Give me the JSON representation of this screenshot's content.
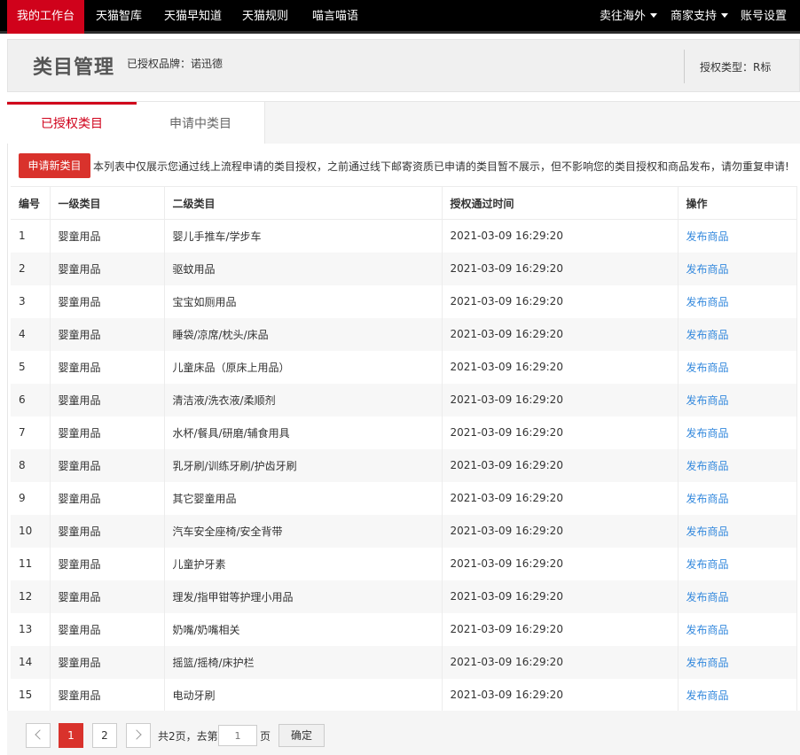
{
  "topnav": {
    "left_items": [
      "我的工作台",
      "天猫智库",
      "天猫早知道",
      "天猫规则",
      "喵言喵语"
    ],
    "right_items": [
      "卖往海外",
      "商家支持",
      "账号设置"
    ]
  },
  "header": {
    "title": "类目管理",
    "brand_text": "已授权品牌：诺迅德",
    "auth_type_text": "授权类型：R标"
  },
  "tabs": {
    "active": "已授权类目",
    "inactive": "申请中类目"
  },
  "toolbar": {
    "apply_button": "申请新类目",
    "notice": "本列表中仅展示您通过线上流程申请的类目授权，之前通过线下邮寄资质已申请的类目暂不展示，但不影响您的类目授权和商品发布，请勿重复申请!"
  },
  "table": {
    "headers": [
      "编号",
      "一级类目",
      "二级类目",
      "授权通过时间",
      "操作"
    ],
    "rows": [
      [
        "1",
        "婴童用品",
        "婴儿手推车/学步车",
        "2021-03-09 16:29:20",
        "发布商品"
      ],
      [
        "2",
        "婴童用品",
        "驱蚊用品",
        "2021-03-09 16:29:20",
        "发布商品"
      ],
      [
        "3",
        "婴童用品",
        "宝宝如厕用品",
        "2021-03-09 16:29:20",
        "发布商品"
      ],
      [
        "4",
        "婴童用品",
        "睡袋/凉席/枕头/床品",
        "2021-03-09 16:29:20",
        "发布商品"
      ],
      [
        "5",
        "婴童用品",
        "儿童床品（原床上用品）",
        "2021-03-09 16:29:20",
        "发布商品"
      ],
      [
        "6",
        "婴童用品",
        "清洁液/洗衣液/柔顺剂",
        "2021-03-09 16:29:20",
        "发布商品"
      ],
      [
        "7",
        "婴童用品",
        "水杯/餐具/研磨/辅食用具",
        "2021-03-09 16:29:20",
        "发布商品"
      ],
      [
        "8",
        "婴童用品",
        "乳牙刷/训练牙刷/护齿牙刷",
        "2021-03-09 16:29:20",
        "发布商品"
      ],
      [
        "9",
        "婴童用品",
        "其它婴童用品",
        "2021-03-09 16:29:20",
        "发布商品"
      ],
      [
        "10",
        "婴童用品",
        "汽车安全座椅/安全背带",
        "2021-03-09 16:29:20",
        "发布商品"
      ],
      [
        "11",
        "婴童用品",
        "儿童护牙素",
        "2021-03-09 16:29:20",
        "发布商品"
      ],
      [
        "12",
        "婴童用品",
        "理发/指甲钳等护理小用品",
        "2021-03-09 16:29:20",
        "发布商品"
      ],
      [
        "13",
        "婴童用品",
        "奶嘴/奶嘴相关",
        "2021-03-09 16:29:20",
        "发布商品"
      ],
      [
        "14",
        "婴童用品",
        "摇篮/摇椅/床护栏",
        "2021-03-09 16:29:20",
        "发布商品"
      ],
      [
        "15",
        "婴童用品",
        "电动牙刷",
        "2021-03-09 16:29:20",
        "发布商品"
      ]
    ]
  },
  "pagination": {
    "pages": [
      "1",
      "2"
    ],
    "current": "1",
    "total_text": "共2页，去第",
    "page_input_placeholder": "1",
    "page_suffix": "页",
    "confirm_label": "确定"
  },
  "colors": {
    "accent": "#d0021b",
    "link": "#3388dd"
  }
}
